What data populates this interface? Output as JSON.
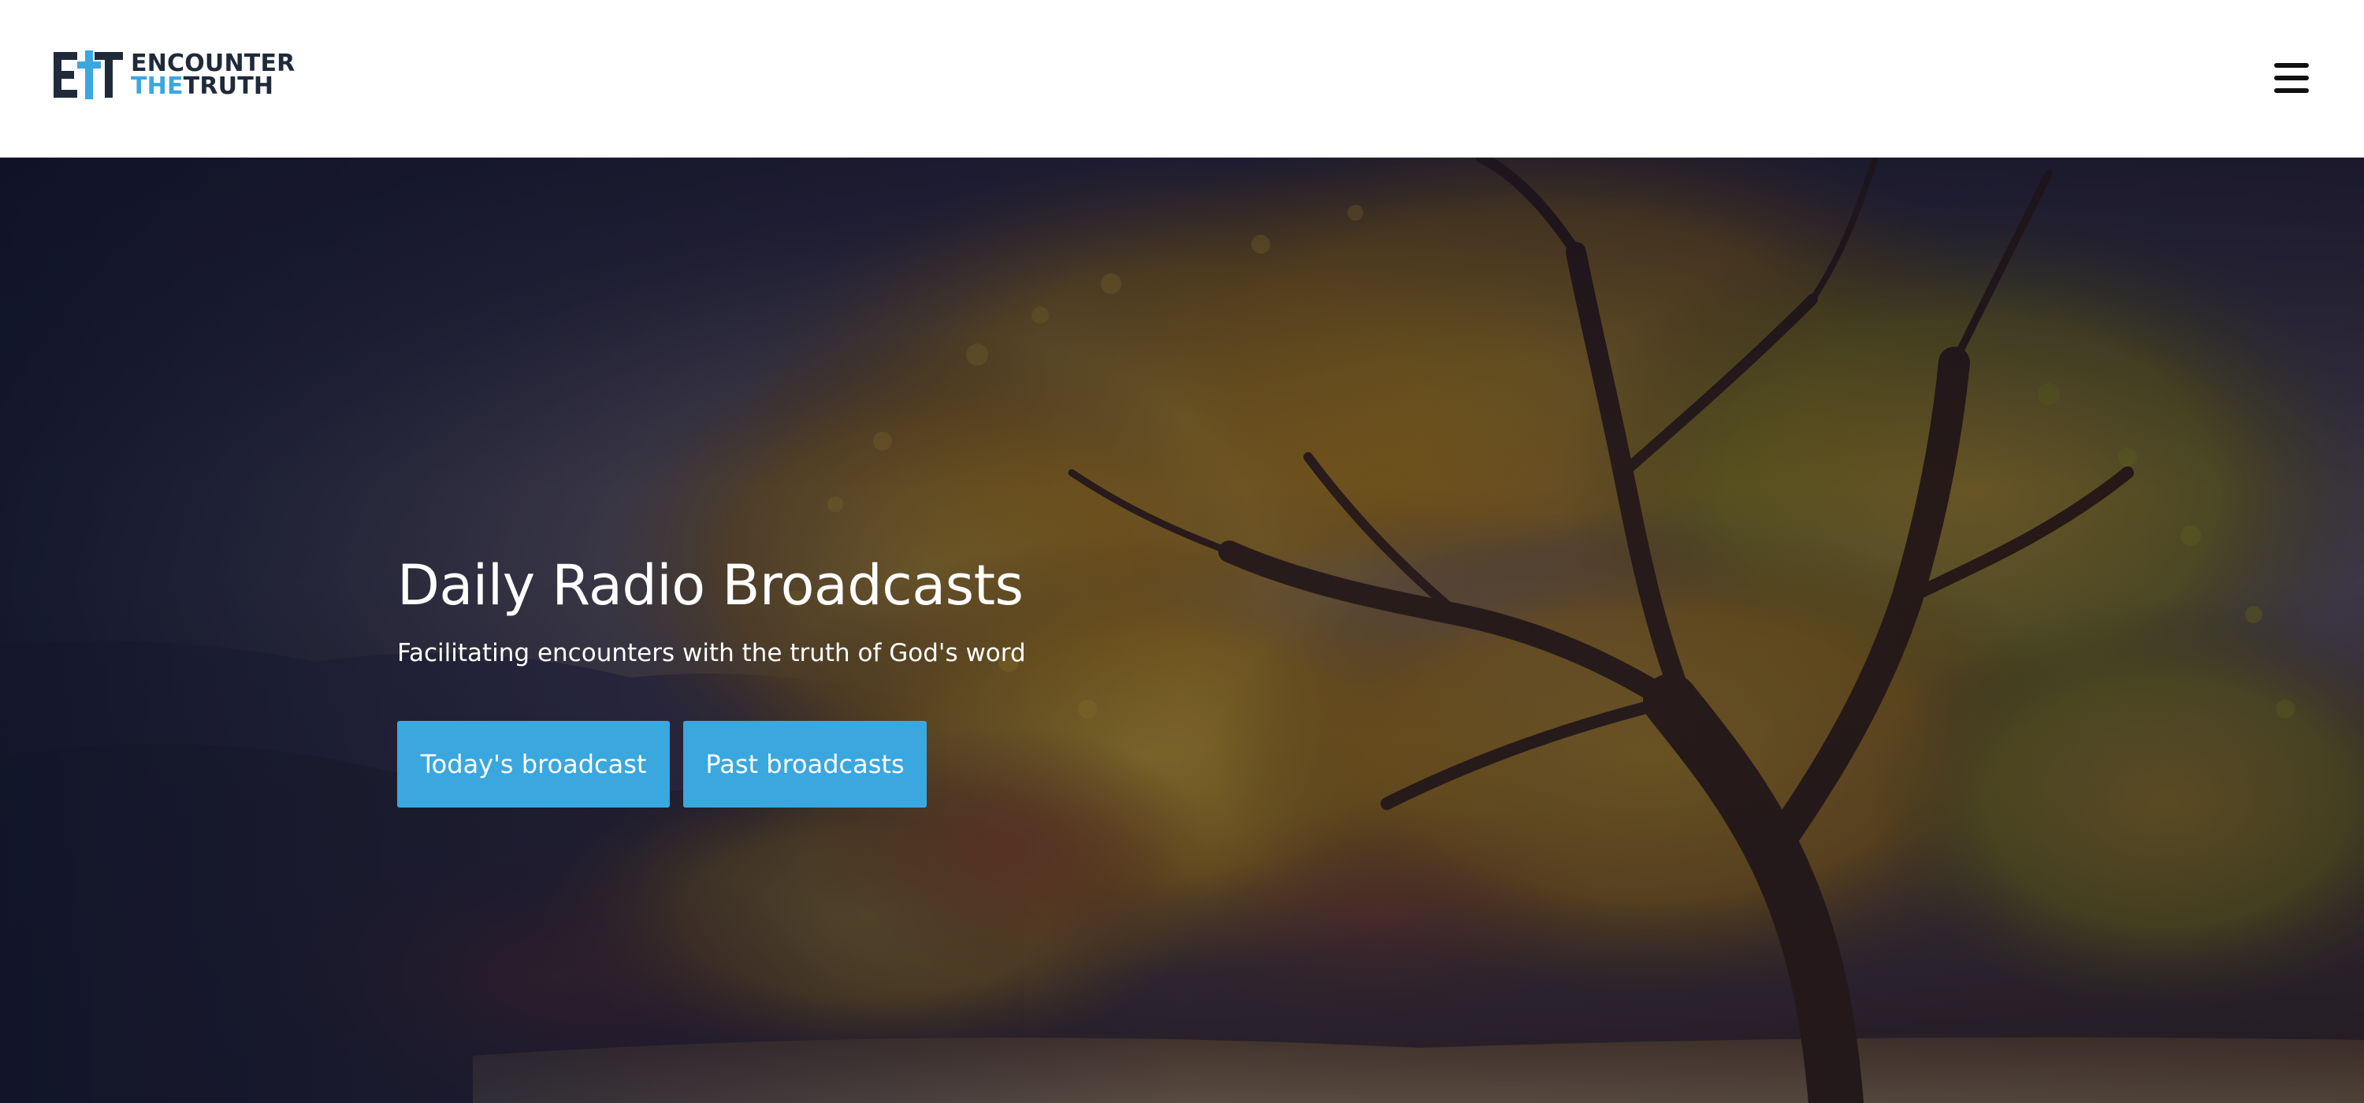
{
  "header": {
    "logo": {
      "mark_text": "ET",
      "line1": "ENCOUNTER",
      "line2_accent": "THE",
      "line2_rest": "TRUTH"
    },
    "menu_icon": "hamburger-menu-icon"
  },
  "hero": {
    "background": "autumn-tree-photo",
    "title": "Daily Radio Broadcasts",
    "subtitle": "Facilitating encounters with the truth of God's word",
    "buttons": [
      {
        "label": "Today's broadcast"
      },
      {
        "label": "Past broadcasts"
      }
    ]
  },
  "colors": {
    "accent": "#3ba7e0",
    "logo_dark": "#1f2a3a",
    "header_bg": "#ffffff",
    "button_bg": "#3aa7df",
    "text_light": "#ffffff"
  }
}
